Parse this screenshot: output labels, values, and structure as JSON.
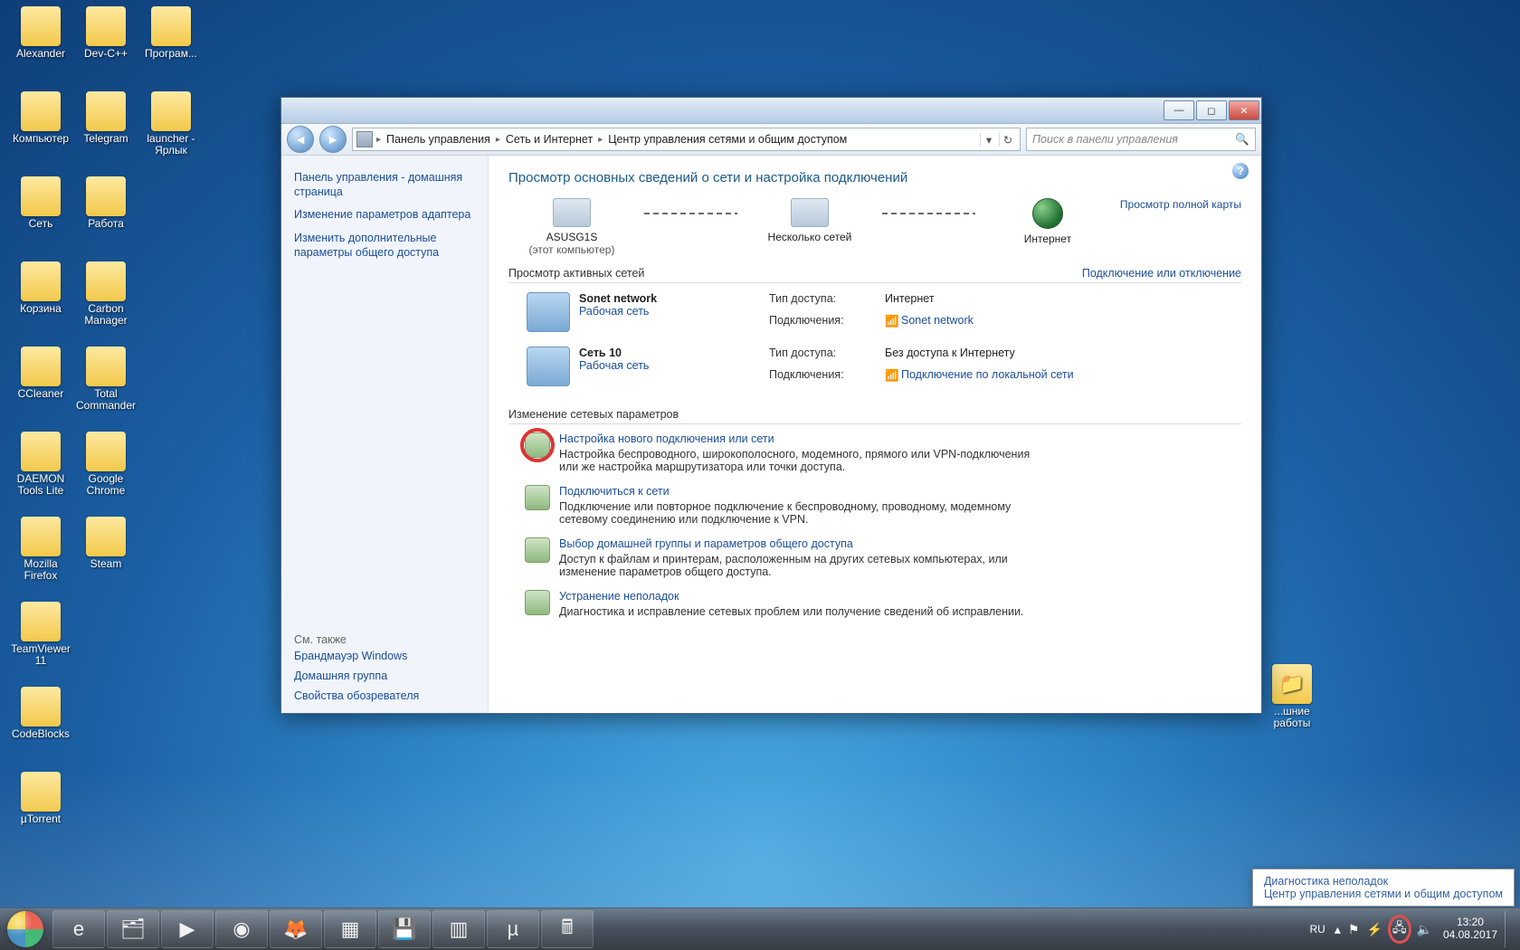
{
  "desktop_icons": [
    [
      {
        "label": "Alexander"
      },
      {
        "label": "Dev-C++"
      },
      {
        "label": "Програм..."
      }
    ],
    [
      {
        "label": "Компьютер"
      },
      {
        "label": "Telegram"
      },
      {
        "label": "launcher - Ярлык"
      }
    ],
    [
      {
        "label": "Сеть"
      },
      {
        "label": "Работа"
      }
    ],
    [
      {
        "label": "Корзина"
      },
      {
        "label": "Carbon Manager"
      }
    ],
    [
      {
        "label": "CCleaner"
      },
      {
        "label": "Total Commander"
      }
    ],
    [
      {
        "label": "DAEMON Tools Lite"
      },
      {
        "label": "Google Chrome"
      }
    ],
    [
      {
        "label": "Mozilla Firefox"
      },
      {
        "label": "Steam"
      }
    ],
    [
      {
        "label": "TeamViewer 11"
      }
    ],
    [
      {
        "label": "CodeBlocks"
      }
    ],
    [
      {
        "label": "µTorrent"
      }
    ]
  ],
  "desktop_icon_right": {
    "label": "...шние работы"
  },
  "taskbar": {
    "icons": [
      "IE",
      "Explorer",
      "Player",
      "Chrome",
      "Firefox",
      "Start",
      "Save",
      "Tiles",
      "uTorrent",
      "Calc"
    ]
  },
  "tray": {
    "lang": "RU",
    "time": "13:20",
    "date": "04.08.2017"
  },
  "tray_popup": {
    "diag": "Диагностика неполадок",
    "center": "Центр управления сетями и общим доступом"
  },
  "window": {
    "breadcrumbs": [
      "Панель управления",
      "Сеть и Интернет",
      "Центр управления сетями и общим доступом"
    ],
    "search_placeholder": "Поиск в панели управления",
    "sidebar": {
      "home": "Панель управления - домашняя страница",
      "links": [
        "Изменение параметров адаптера",
        "Изменить дополнительные параметры общего доступа"
      ],
      "seealso_header": "См. также",
      "seealso": [
        "Брандмауэр Windows",
        "Домашняя группа",
        "Свойства обозревателя"
      ]
    },
    "page_title": "Просмотр основных сведений о сети и настройка подключений",
    "map_link": "Просмотр полной карты",
    "diagram": {
      "this_pc": "ASUSG1S",
      "this_pc_sub": "(этот компьютер)",
      "middle": "Несколько сетей",
      "internet": "Интернет"
    },
    "active_header": "Просмотр активных сетей",
    "active_right": "Подключение или отключение",
    "networks": [
      {
        "name": "Sonet network",
        "type": "Рабочая сеть",
        "meta": [
          [
            "Тип доступа:",
            "Интернет"
          ],
          [
            "Подключения:",
            "Sonet network"
          ]
        ],
        "conn_is_link": true
      },
      {
        "name": "Сеть  10",
        "type": "Рабочая сеть",
        "meta": [
          [
            "Тип доступа:",
            "Без доступа к Интернету"
          ],
          [
            "Подключения:",
            "Подключение по локальной сети"
          ]
        ],
        "conn_is_link": true
      }
    ],
    "settings_header": "Изменение сетевых параметров",
    "settings": [
      {
        "title": "Настройка нового подключения или сети",
        "desc": "Настройка беспроводного, широкополосного, модемного, прямого или VPN-подключения или же настройка маршрутизатора или точки доступа.",
        "highlight": true
      },
      {
        "title": "Подключиться к сети",
        "desc": "Подключение или повторное подключение к беспроводному, проводному, модемному сетевому соединению или подключение к VPN."
      },
      {
        "title": "Выбор домашней группы и параметров общего доступа",
        "desc": "Доступ к файлам и принтерам, расположенным на других сетевых компьютерах, или изменение параметров общего доступа."
      },
      {
        "title": "Устранение неполадок",
        "desc": "Диагностика и исправление сетевых проблем или получение сведений об исправлении."
      }
    ]
  }
}
